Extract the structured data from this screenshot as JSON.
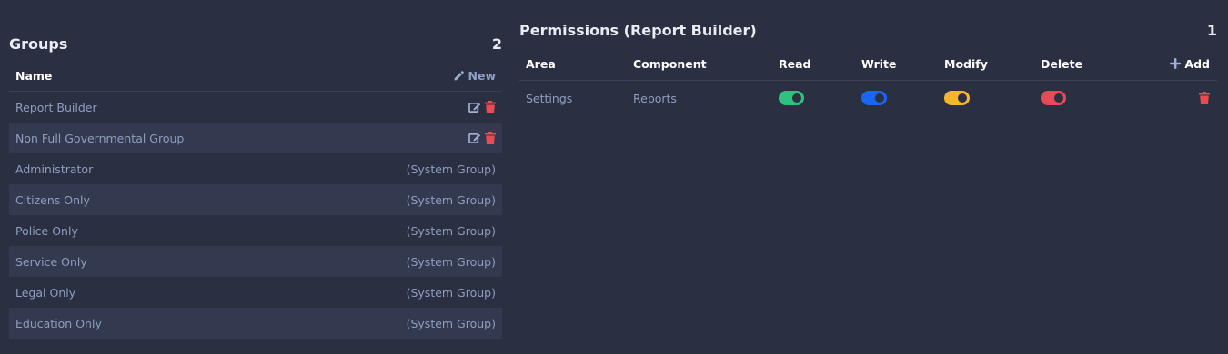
{
  "groups": {
    "title": "Groups",
    "count": "2",
    "name_header": "Name",
    "new_label": "New",
    "rows": [
      {
        "name": "Report Builder",
        "system": ""
      },
      {
        "name": "Non Full Governmental Group",
        "system": ""
      },
      {
        "name": "Administrator",
        "system": "(System Group)"
      },
      {
        "name": "Citizens Only",
        "system": "(System Group)"
      },
      {
        "name": "Police Only",
        "system": "(System Group)"
      },
      {
        "name": "Service Only",
        "system": "(System Group)"
      },
      {
        "name": "Legal Only",
        "system": "(System Group)"
      },
      {
        "name": "Education Only",
        "system": "(System Group)"
      }
    ]
  },
  "permissions": {
    "title": "Permissions (Report Builder)",
    "count": "1",
    "headers": {
      "area": "Area",
      "component": "Component",
      "read": "Read",
      "write": "Write",
      "modify": "Modify",
      "delete": "Delete"
    },
    "add_label": "Add",
    "rows": [
      {
        "area": "Settings",
        "component": "Reports",
        "read": true,
        "write": true,
        "modify": true,
        "delete": true
      }
    ]
  },
  "colors": {
    "background": "#2a2f42",
    "read_toggle": "#2ec27e",
    "write_toggle": "#1a66f2",
    "modify_toggle": "#f6b62c",
    "delete_toggle": "#e84a55",
    "trash_icon": "#ea4a52",
    "edit_icon": "#9fb0d4"
  },
  "icons": {
    "new": "pencil-icon",
    "edit": "edit-icon",
    "delete": "trash-icon",
    "add": "plus-icon"
  }
}
